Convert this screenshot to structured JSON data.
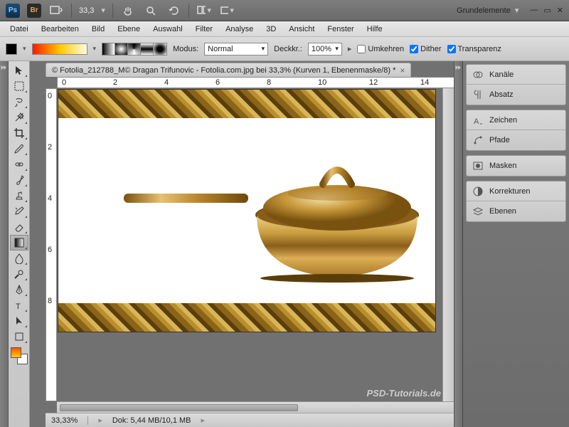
{
  "topbar": {
    "zoom": "33,3",
    "workspace": "Grundelemente"
  },
  "menu": [
    "Datei",
    "Bearbeiten",
    "Bild",
    "Ebene",
    "Auswahl",
    "Filter",
    "Analyse",
    "3D",
    "Ansicht",
    "Fenster",
    "Hilfe"
  ],
  "options": {
    "modus_label": "Modus:",
    "modus_value": "Normal",
    "deckkr_label": "Deckkr.:",
    "deckkr_value": "100%",
    "umkehren": "Umkehren",
    "dither": "Dither",
    "transparenz": "Transparenz"
  },
  "document": {
    "tab": "© Fotolia_212788_M© Dragan Trifunovic - Fotolia.com.jpg bei 33,3% (Kurven 1, Ebenenmaske/8) *"
  },
  "ruler_h": [
    "0",
    "2",
    "4",
    "6",
    "8",
    "10",
    "12",
    "14"
  ],
  "ruler_v": [
    "0",
    "2",
    "4",
    "6",
    "8"
  ],
  "status": {
    "zoom": "33,33%",
    "dok": "Dok: 5,44 MB/10,1 MB"
  },
  "panels": {
    "g1": [
      "Kanäle",
      "Absatz"
    ],
    "g2": [
      "Zeichen",
      "Pfade"
    ],
    "g3": [
      "Masken"
    ],
    "g4": [
      "Korrekturen",
      "Ebenen"
    ]
  },
  "watermark": "PSD-Tutorials.de"
}
